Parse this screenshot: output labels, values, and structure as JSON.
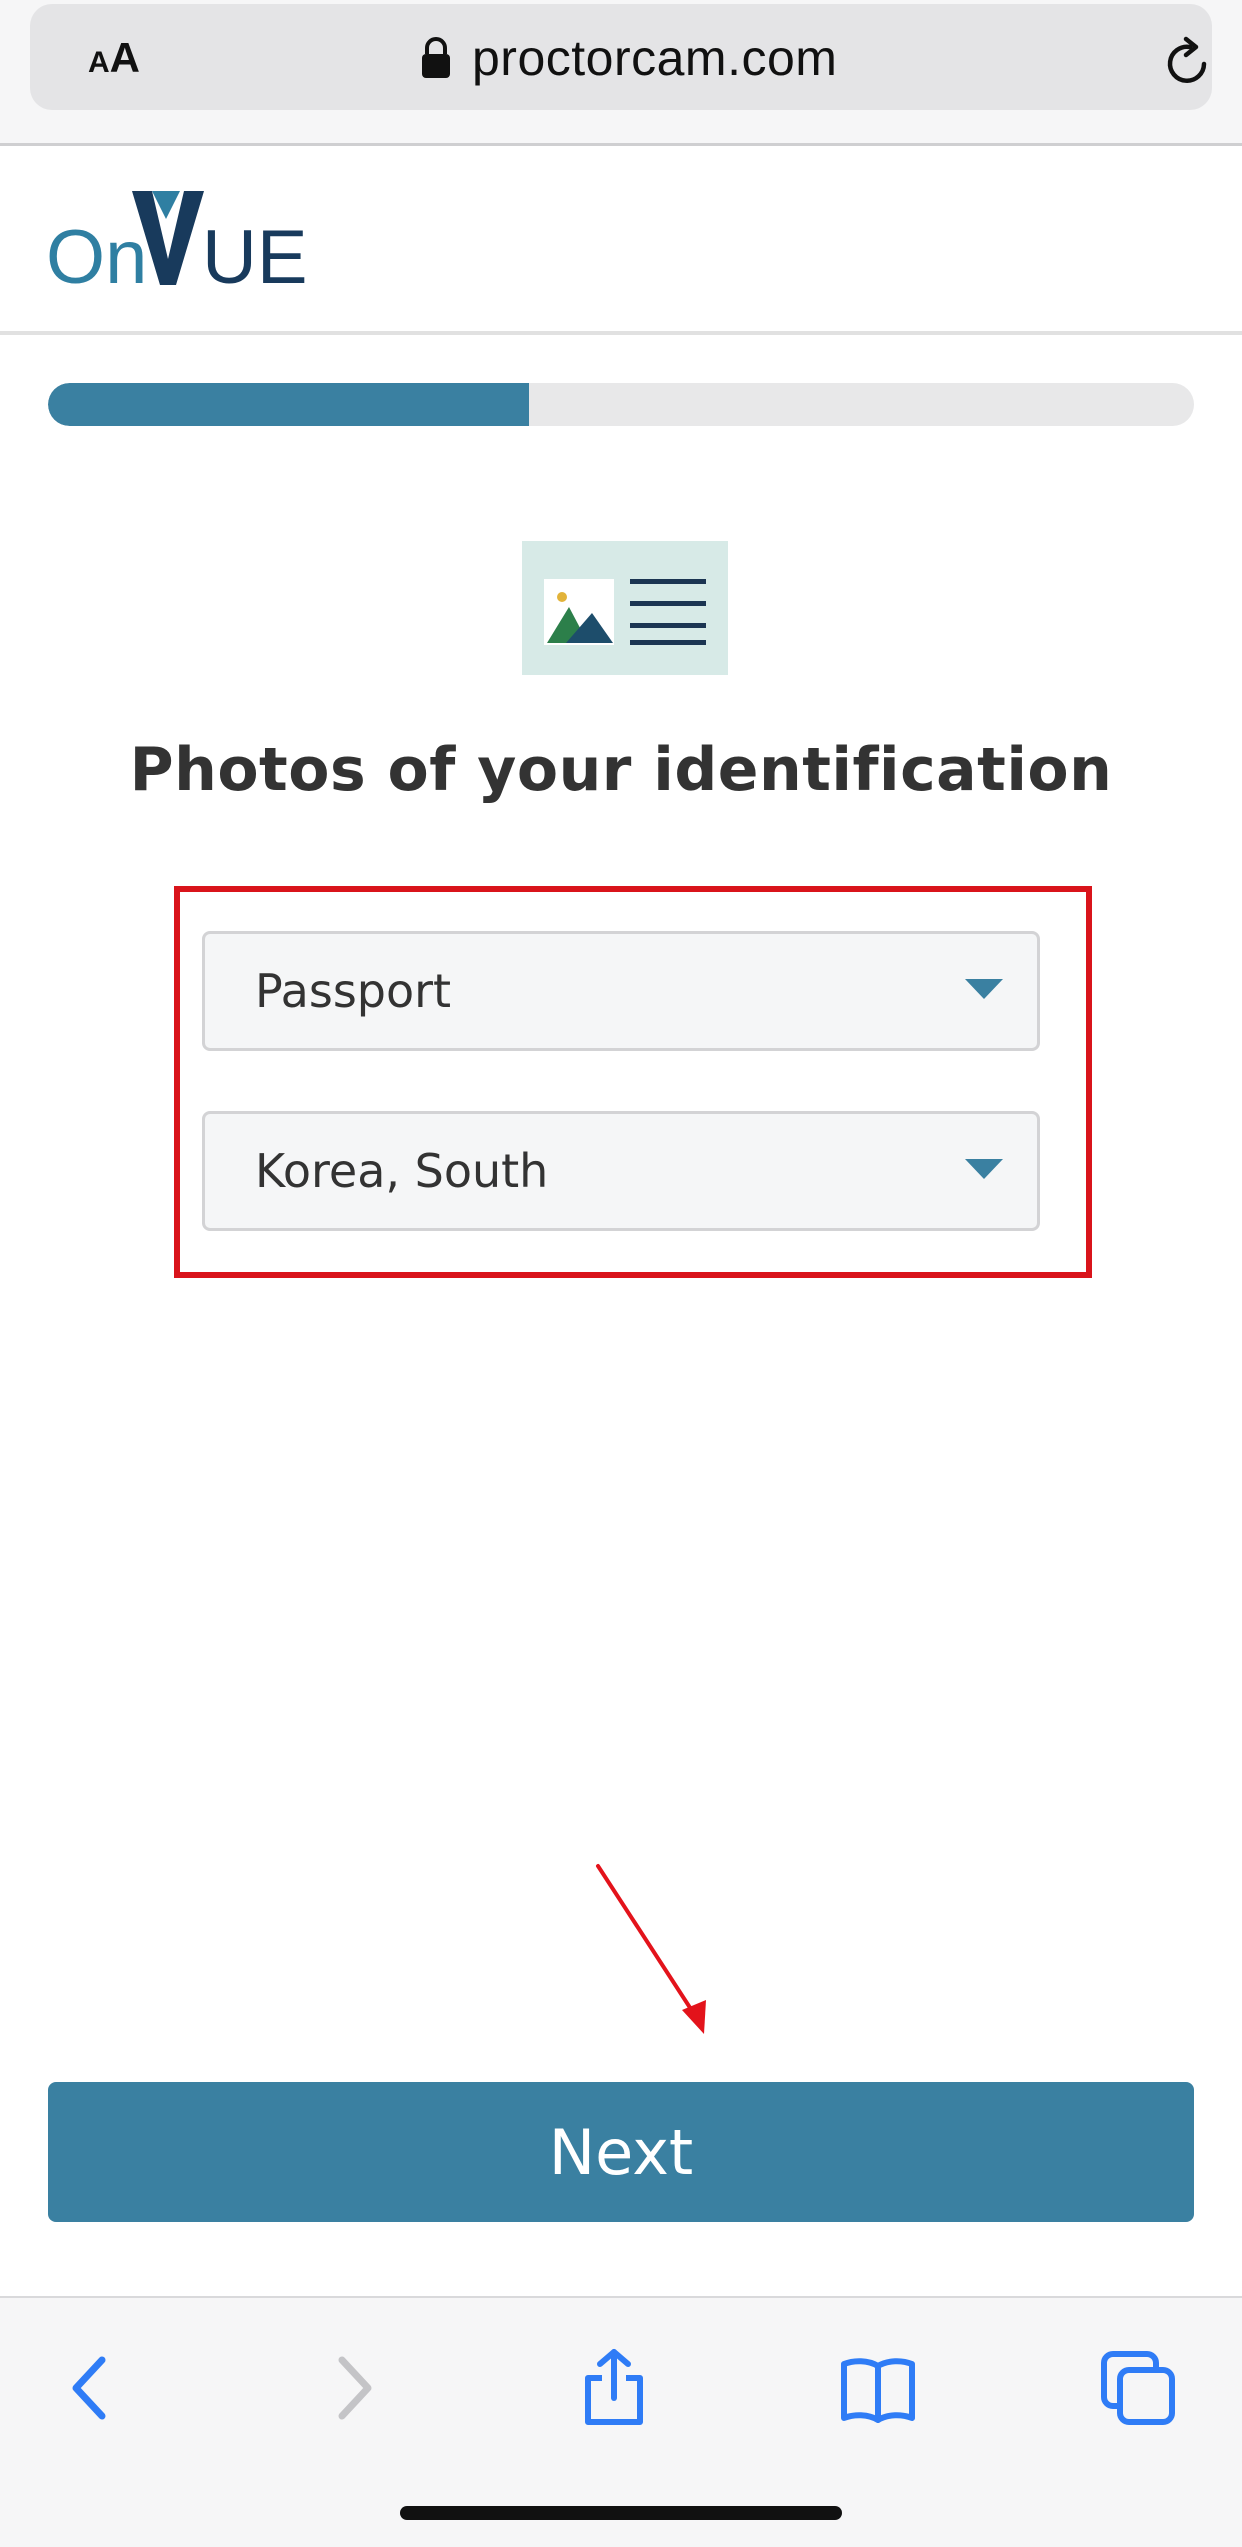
{
  "browser": {
    "text_size_small": "A",
    "text_size_large": "A",
    "url": "proctorcam.com"
  },
  "header": {
    "logo_text_on": "On",
    "logo_text_v": "V",
    "logo_text_ue": "UE"
  },
  "progress": {
    "fraction": 0.42
  },
  "main": {
    "heading": "Photos of your identification",
    "id_type_select": {
      "value": "Passport"
    },
    "country_select": {
      "value": "Korea, South"
    },
    "next_label": "Next"
  },
  "colors": {
    "accent": "#3a80a1",
    "highlight": "#d9141b",
    "logo_dark": "#183a5c",
    "logo_light": "#2f7fa2"
  },
  "icons": [
    "lock-icon",
    "reload-icon",
    "id-card-icon",
    "chevron-left-icon",
    "chevron-right-icon",
    "share-icon",
    "book-icon",
    "tabs-icon"
  ]
}
